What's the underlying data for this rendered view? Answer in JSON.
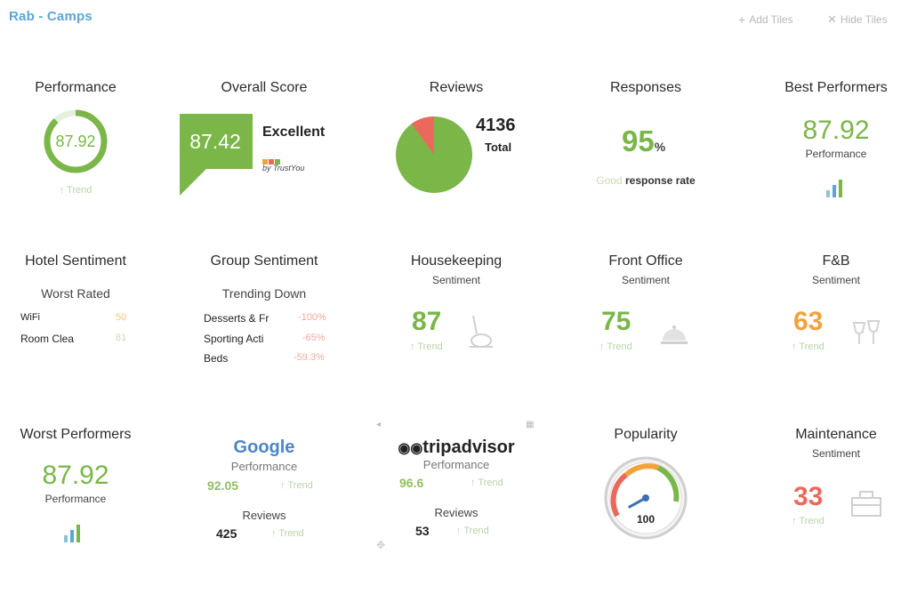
{
  "header": {
    "brand": "Rab - Camps",
    "add_tiles": "Add Tiles",
    "hide_tiles": "Hide Tiles"
  },
  "tiles": {
    "performance": {
      "title": "Performance",
      "score": "87.92",
      "trend": "Trend",
      "progress": 0.8792,
      "color": "#7ab648"
    },
    "overall": {
      "title": "Overall Score",
      "score": "87.42",
      "label": "Excellent",
      "byline": "by TrustYou",
      "color": "#7ab648"
    },
    "reviews": {
      "title": "Reviews",
      "total_value": "4136",
      "total_label": "Total",
      "positive_share": 0.9,
      "colors": [
        "#7ab648",
        "#e96a5c"
      ]
    },
    "responses": {
      "title": "Responses",
      "value": "95",
      "unit": "%",
      "qualifier": "Good",
      "text": "response rate"
    },
    "best": {
      "title": "Best Performers",
      "value": "87.92",
      "label": "Performance"
    },
    "hotel_sentiment": {
      "title": "Hotel Sentiment",
      "subtitle": "Worst Rated",
      "items": [
        {
          "label": "WiFi",
          "value": "50"
        },
        {
          "label": "Room Clea",
          "value": "81"
        }
      ]
    },
    "group_sentiment": {
      "title": "Group Sentiment",
      "subtitle": "Trending Down",
      "items": [
        {
          "label": "Desserts & Fr",
          "value": "-100%"
        },
        {
          "label": "Sporting Acti",
          "value": "-65%"
        },
        {
          "label": "Beds",
          "value": "-59.3%"
        }
      ]
    },
    "housekeeping": {
      "title": "Housekeeping",
      "subtitle": "Sentiment",
      "value": "87",
      "trend": "Trend"
    },
    "front_office": {
      "title": "Front Office",
      "subtitle": "Sentiment",
      "value": "75",
      "trend": "Trend"
    },
    "fnb": {
      "title": "F&B",
      "subtitle": "Sentiment",
      "value": "63",
      "trend": "Trend"
    },
    "worst": {
      "title": "Worst Performers",
      "value": "87.92",
      "label": "Performance"
    },
    "google": {
      "logo": "Google",
      "subtitle": "Performance",
      "value": "92.05",
      "trend": "Trend",
      "reviews_label": "Reviews",
      "reviews_value": "425"
    },
    "tripadvisor": {
      "logo": "tripadvisor",
      "subtitle": "Performance",
      "value": "96.6",
      "trend": "Trend",
      "reviews_label": "Reviews",
      "reviews_value": "53"
    },
    "popularity": {
      "title": "Popularity",
      "value": "100",
      "level": 1.0
    },
    "maintenance": {
      "title": "Maintenance",
      "subtitle": "Sentiment",
      "value": "33",
      "trend": "Trend"
    }
  }
}
